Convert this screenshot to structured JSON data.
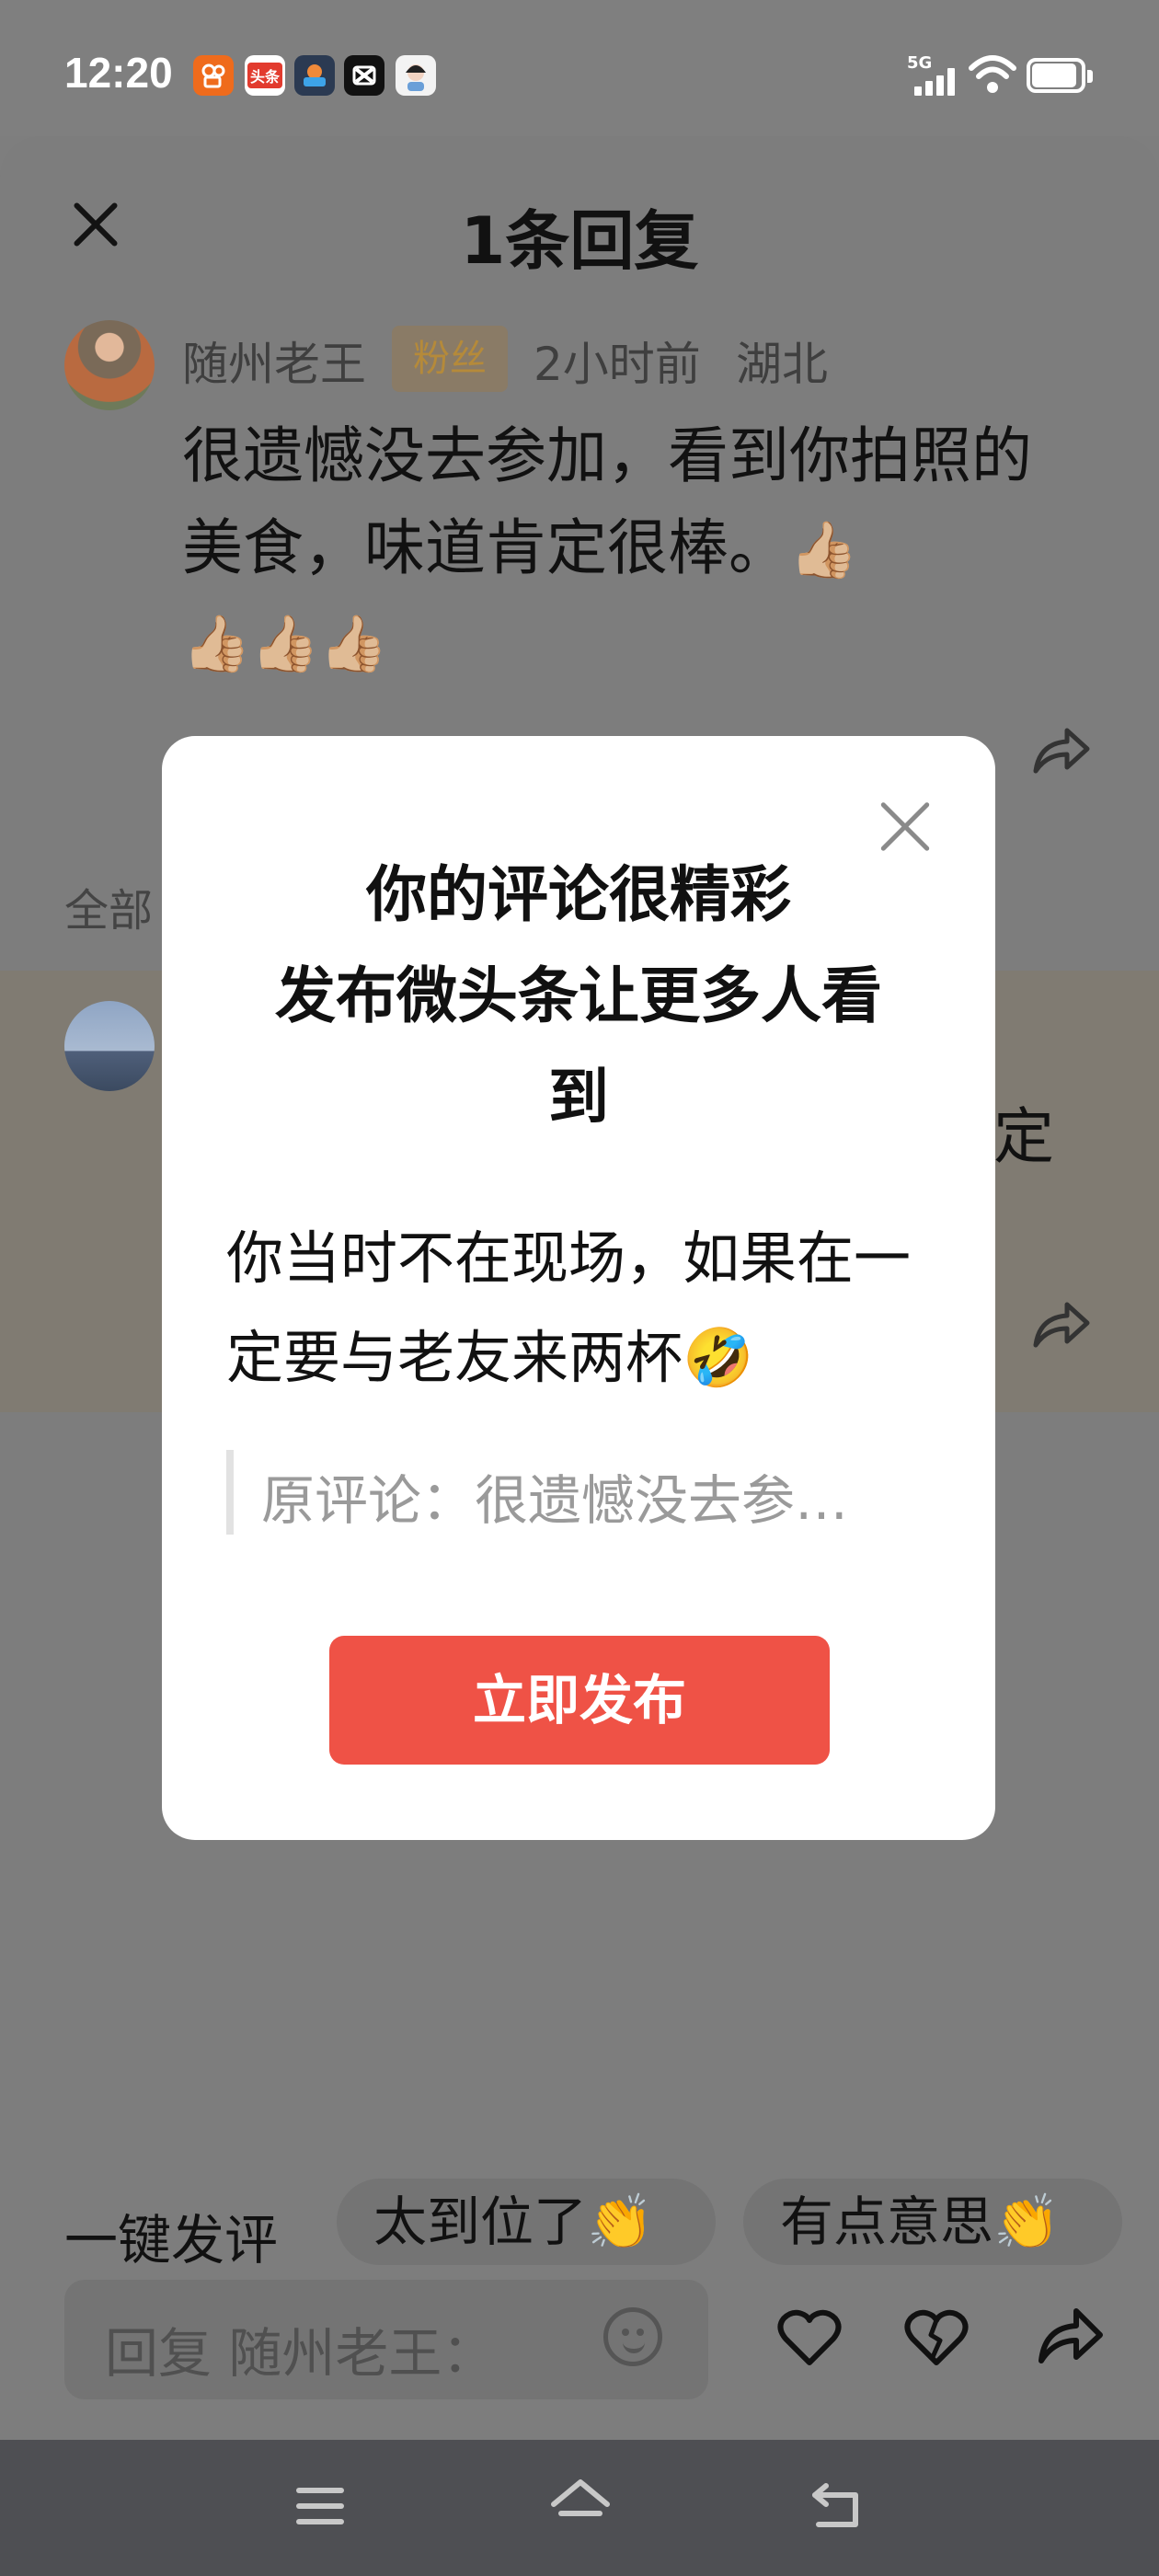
{
  "status_bar": {
    "time": "12:20",
    "network": "5G",
    "app_icons": [
      "kuaishou-icon",
      "toutiao-icon",
      "game-icon",
      "capcut-icon",
      "avatar-app-icon"
    ],
    "app_icon_labels": {
      "toutiao": "头条"
    }
  },
  "sheet": {
    "title": "1条回复",
    "comment": {
      "author": "随州老王",
      "badge": "粉丝",
      "time": "2小时前",
      "location": "湖北",
      "text": "很遗憾没去参加，看到你拍照的美食，味道肯定很棒。",
      "emoji": "👍🏼",
      "emoji_trailing": "👍🏼👍🏼👍🏼"
    },
    "section_label": "全部",
    "reply_fragment": "定"
  },
  "quick_comments": {
    "label": "一键发评",
    "chips": [
      "太到位了👏",
      "有点意思👏"
    ]
  },
  "reply_box": {
    "placeholder": "回复 随州老王："
  },
  "modal": {
    "title_lines": [
      "你的评论很精彩",
      "发布微头条让更多人看",
      "到"
    ],
    "comment_text": "你当时不在现场，如果在一定要与老友来两杯",
    "comment_emoji": "🤣",
    "quote": "原评论：很遗憾没去参…",
    "button_label": "立即发布"
  },
  "colors": {
    "accent": "#ef5246",
    "overlay": "#7e7e7e",
    "navbar": "#4e4f53"
  }
}
